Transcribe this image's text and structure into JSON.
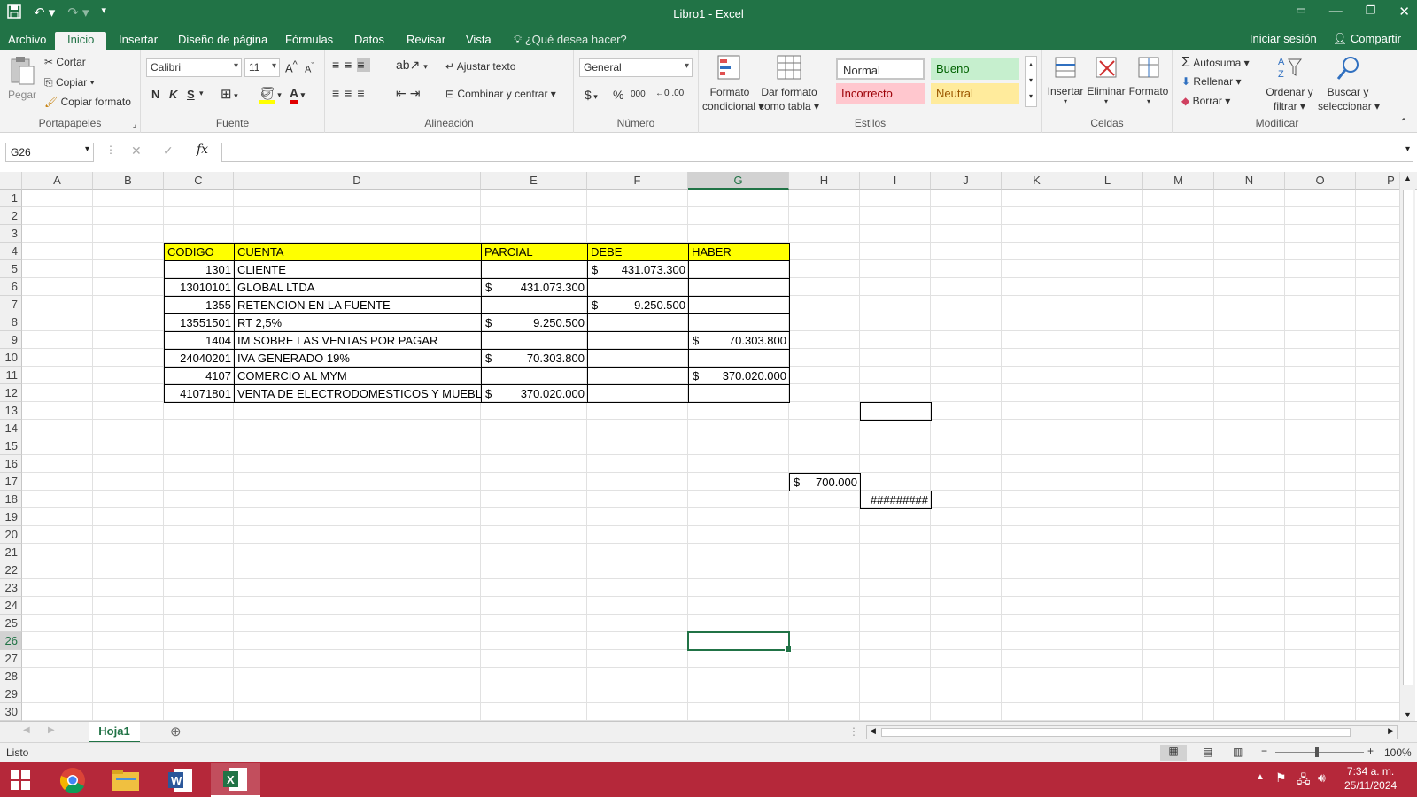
{
  "window": {
    "title": "Libro1 - Excel"
  },
  "tabs": [
    "Archivo",
    "Inicio",
    "Insertar",
    "Diseño de página",
    "Fórmulas",
    "Datos",
    "Revisar",
    "Vista"
  ],
  "tell_me": "¿Qué desea hacer?",
  "account": {
    "signin": "Iniciar sesión",
    "share": "Compartir"
  },
  "ribbon": {
    "clipboard": {
      "paste": "Pegar",
      "cut": "Cortar",
      "copy": "Copiar",
      "format_painter": "Copiar formato",
      "label": "Portapapeles"
    },
    "font": {
      "name": "Calibri",
      "size": "11",
      "bold": "N",
      "italic": "K",
      "underline": "S",
      "label": "Fuente"
    },
    "alignment": {
      "wrap": "Ajustar texto",
      "merge": "Combinar y centrar",
      "label": "Alineación"
    },
    "number": {
      "format": "General",
      "currency": "$",
      "percent": "%",
      "thousands": "000",
      "label": "Número"
    },
    "styles": {
      "conditional": "Formato condicional",
      "conditional_l1": "Formato",
      "conditional_l2": "condicional",
      "as_table_l1": "Dar formato",
      "as_table_l2": "como tabla",
      "normal": "Normal",
      "good": "Bueno",
      "bad": "Incorrecto",
      "neutral": "Neutral",
      "label": "Estilos"
    },
    "cells": {
      "insert": "Insertar",
      "delete": "Eliminar",
      "format": "Formato",
      "label": "Celdas"
    },
    "editing": {
      "autosum": "Autosuma",
      "fill": "Rellenar",
      "clear": "Borrar",
      "sort_l1": "Ordenar y",
      "sort_l2": "filtrar",
      "find_l1": "Buscar y",
      "find_l2": "seleccionar",
      "label": "Modificar"
    }
  },
  "formula_bar": {
    "name_box": "G26",
    "formula": ""
  },
  "columns": [
    "A",
    "B",
    "C",
    "D",
    "E",
    "F",
    "G",
    "H",
    "I",
    "J",
    "K",
    "L",
    "M",
    "N",
    "O",
    "P"
  ],
  "rows": [
    "1",
    "2",
    "3",
    "4",
    "5",
    "6",
    "7",
    "8",
    "9",
    "10",
    "11",
    "12",
    "13",
    "14",
    "15",
    "16",
    "17",
    "18",
    "19",
    "20",
    "21",
    "22",
    "23",
    "24",
    "25",
    "26",
    "27",
    "28",
    "29",
    "30"
  ],
  "table": {
    "headers": {
      "codigo": "CODIGO",
      "cuenta": "CUENTA",
      "parcial": "PARCIAL",
      "debe": "DEBE",
      "haber": "HABER"
    },
    "rows": [
      {
        "codigo": "1301",
        "cuenta": "CLIENTE",
        "parcial": "",
        "debe": "431.073.300",
        "haber": ""
      },
      {
        "codigo": "13010101",
        "cuenta": "GLOBAL LTDA",
        "parcial": "431.073.300",
        "debe": "",
        "haber": ""
      },
      {
        "codigo": "1355",
        "cuenta": "RETENCION EN LA FUENTE",
        "parcial": "",
        "debe": "9.250.500",
        "haber": ""
      },
      {
        "codigo": "13551501",
        "cuenta": "RT 2,5%",
        "parcial": "9.250.500",
        "debe": "",
        "haber": ""
      },
      {
        "codigo": "1404",
        "cuenta": "IM SOBRE LAS VENTAS POR PAGAR",
        "parcial": "",
        "debe": "",
        "haber": "70.303.800"
      },
      {
        "codigo": "24040201",
        "cuenta": "IVA GENERADO 19%",
        "parcial": "70.303.800",
        "debe": "",
        "haber": ""
      },
      {
        "codigo": "4107",
        "cuenta": "COMERCIO AL MYM",
        "parcial": "",
        "debe": "",
        "haber": "370.020.000"
      },
      {
        "codigo": "41071801",
        "cuenta": "VENTA DE ELECTRODOMESTICOS Y MUEBLES",
        "parcial": "370.020.000",
        "debe": "",
        "haber": ""
      }
    ],
    "currency_symbol": "$"
  },
  "extra_cells": {
    "h17": "700.000",
    "i18": "#########"
  },
  "sheets": [
    "Hoja1"
  ],
  "status": {
    "ready": "Listo",
    "zoom": "100%"
  },
  "taskbar": {
    "time": "7:34 a. m.",
    "date": "25/11/2024"
  },
  "colors": {
    "excel_green": "#217346",
    "header_yellow": "#ffff00",
    "taskbar": "#b5283a"
  }
}
